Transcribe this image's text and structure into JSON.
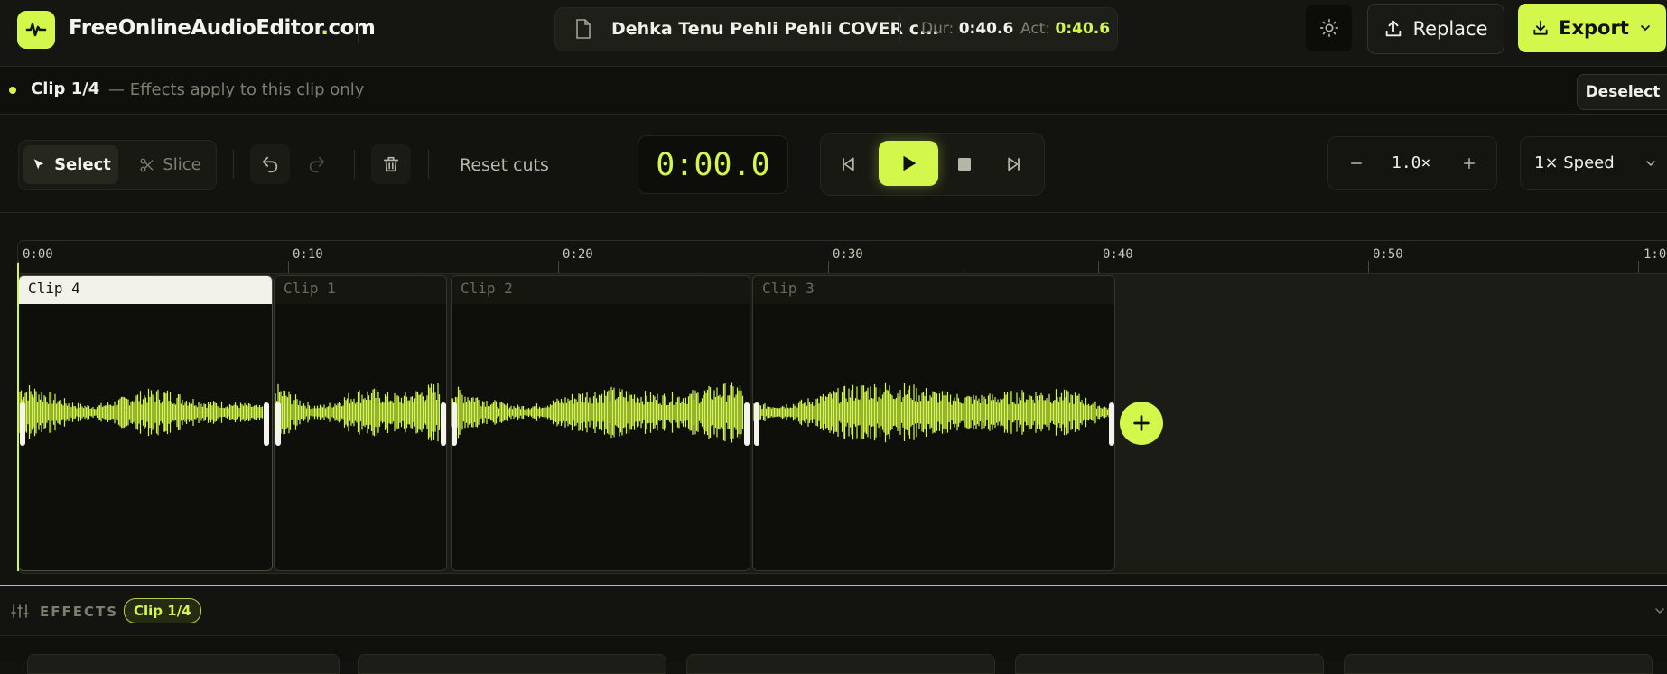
{
  "header": {
    "brand_name": "FreeOnlineAudioEditor",
    "brand_dot": ".",
    "brand_tld": "com",
    "file_name": "Dehka Tenu Pehli Pehli COVER c...",
    "duration_label": "Dur:",
    "duration_value": "0:40.6",
    "active_label": "Act:",
    "active_value": "0:40.6",
    "replace_label": "Replace",
    "export_label": "Export"
  },
  "clipbar": {
    "title": "Clip 1/4",
    "note": "— Effects apply to this clip only",
    "deselect_label": "Deselect"
  },
  "toolbar": {
    "select_label": "Select",
    "slice_label": "Slice",
    "reset_cuts_label": "Reset cuts",
    "timecode": "0:00.0",
    "zoom_value": "1.0×",
    "speed_value": "1× Speed"
  },
  "timeline": {
    "ticks": [
      "0:00",
      "0:10",
      "0:20",
      "0:30",
      "0:40",
      "0:50",
      "1:0"
    ],
    "clips": [
      {
        "name": "Clip 4",
        "selected": true
      },
      {
        "name": "Clip 1",
        "selected": false
      },
      {
        "name": "Clip 2",
        "selected": false
      },
      {
        "name": "Clip 3",
        "selected": false
      }
    ],
    "waveform_color": "#d3f74b"
  },
  "effects": {
    "label": "EFFECTS",
    "badge": "Clip 1/4"
  },
  "colors": {
    "accent": "#d3f74b",
    "background": "#12130e"
  },
  "icons": [
    "waveform-icon",
    "file-icon",
    "sun-icon",
    "upload-icon",
    "download-icon",
    "chevron-down-icon",
    "cursor-icon",
    "scissors-icon",
    "undo-icon",
    "redo-icon",
    "trash-icon",
    "skip-back-icon",
    "play-icon",
    "stop-icon",
    "skip-forward-icon",
    "minus-icon",
    "plus-icon",
    "sliders-icon",
    "add-clip-icon"
  ]
}
